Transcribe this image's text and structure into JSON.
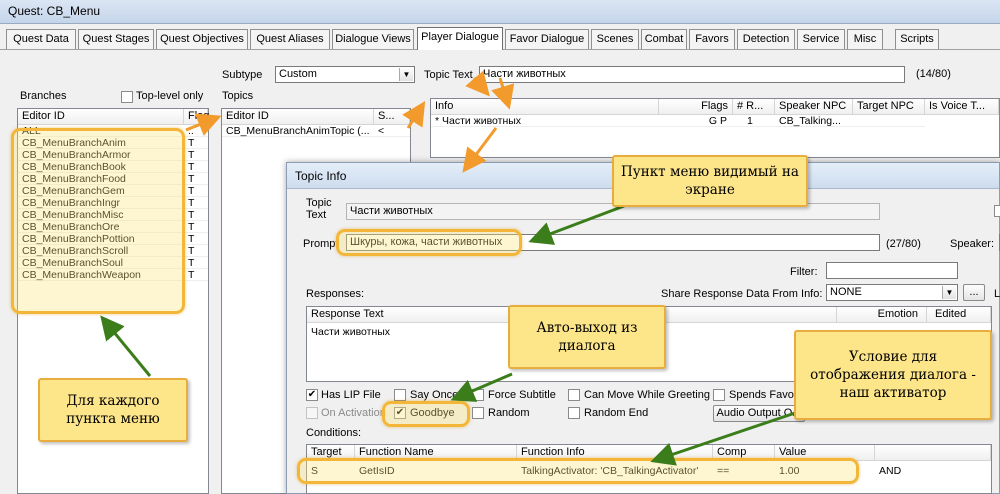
{
  "window": {
    "title": "Quest: CB_Menu"
  },
  "tabs": [
    {
      "label": "Quest Data"
    },
    {
      "label": "Quest Stages"
    },
    {
      "label": "Quest Objectives"
    },
    {
      "label": "Quest Aliases"
    },
    {
      "label": "Dialogue Views"
    },
    {
      "label": "Player Dialogue"
    },
    {
      "label": "Favor Dialogue"
    },
    {
      "label": "Scenes"
    },
    {
      "label": "Combat"
    },
    {
      "label": "Favors"
    },
    {
      "label": "Detection"
    },
    {
      "label": "Service"
    },
    {
      "label": "Misc"
    },
    {
      "label": "Scripts"
    }
  ],
  "branches": {
    "label": "Branches",
    "toplevel_label": "Top-level only",
    "col_editor_id": "Editor ID",
    "col_flags": "Flag",
    "items": [
      {
        "id": "ALL",
        "flag": ".."
      },
      {
        "id": "CB_MenuBranchAnim",
        "flag": "T"
      },
      {
        "id": "CB_MenuBranchArmor",
        "flag": "T"
      },
      {
        "id": "CB_MenuBranchBook",
        "flag": "T"
      },
      {
        "id": "CB_MenuBranchFood",
        "flag": "T"
      },
      {
        "id": "CB_MenuBranchGem",
        "flag": "T"
      },
      {
        "id": "CB_MenuBranchIngr",
        "flag": "T"
      },
      {
        "id": "CB_MenuBranchMisc",
        "flag": "T"
      },
      {
        "id": "CB_MenuBranchOre",
        "flag": "T"
      },
      {
        "id": "CB_MenuBranchPottion",
        "flag": "T"
      },
      {
        "id": "CB_MenuBranchScroll",
        "flag": "T"
      },
      {
        "id": "CB_MenuBranchSoul",
        "flag": "T"
      },
      {
        "id": "CB_MenuBranchWeapon",
        "flag": "T"
      }
    ]
  },
  "subtype": {
    "label": "Subtype",
    "value": "Custom"
  },
  "topics": {
    "label": "Topics",
    "col_editor_id": "Editor ID",
    "col_s": "S...",
    "items": [
      {
        "id": "CB_MenuBranchAnimTopic (...",
        "s": "<"
      }
    ]
  },
  "topic_text": {
    "label": "Topic Text",
    "value": "Части животных",
    "count": "(14/80)"
  },
  "infos": {
    "columns": [
      "Info",
      "Flags",
      "# R...",
      "Speaker NPC",
      "Target NPC",
      "Is Voice T..."
    ],
    "rows": [
      {
        "info": "* Части животных",
        "flags": "G P",
        "r": "1",
        "speaker": "CB_Talking...",
        "target": "",
        "voice": ""
      }
    ]
  },
  "topic_info": {
    "title": "Topic Info",
    "topic_text_label": "Topic Text",
    "topic_text_value": "Части животных",
    "prompt_label": "Prompt",
    "prompt_value": "Шкуры, кожа, части животных",
    "prompt_count": "(27/80)",
    "speaker_label": "Speaker:",
    "filter_label": "Filter:",
    "responses_label": "Responses:",
    "share_label": "Share Response Data From Info:",
    "share_value": "NONE",
    "ellipsis": "...",
    "col_response": "Response Text",
    "col_emotion": "Emotion",
    "col_edited": "Edited",
    "response_text": "Части животных",
    "checks": {
      "has_lip": "Has LIP File",
      "say_once": "Say Once",
      "force_subtitle": "Force Subtitle",
      "can_move": "Can Move While Greeting",
      "spends_favor": "Spends Favor",
      "on_activation": "On Activation",
      "goodbye": "Goodbye",
      "random": "Random",
      "random_end": "Random End"
    },
    "audio_output": "Audio Output O...",
    "conditions_label": "Conditions:",
    "cond_columns": [
      "Target",
      "Function Name",
      "Function Info",
      "Comp",
      "Value"
    ],
    "conditions": [
      {
        "target": "S",
        "function": "GetIsID",
        "info": "TalkingActivator: 'CB_TalkingActivator'",
        "comp": "==",
        "value": "1.00",
        "op": "AND"
      }
    ]
  },
  "callouts": {
    "menu_visible": "Пункт меню видимый на экране",
    "auto_exit": "Авто-выход из диалога",
    "condition": "Условие для отображения диалога - наш активатор",
    "per_item": "Для каждого пункта меню"
  }
}
